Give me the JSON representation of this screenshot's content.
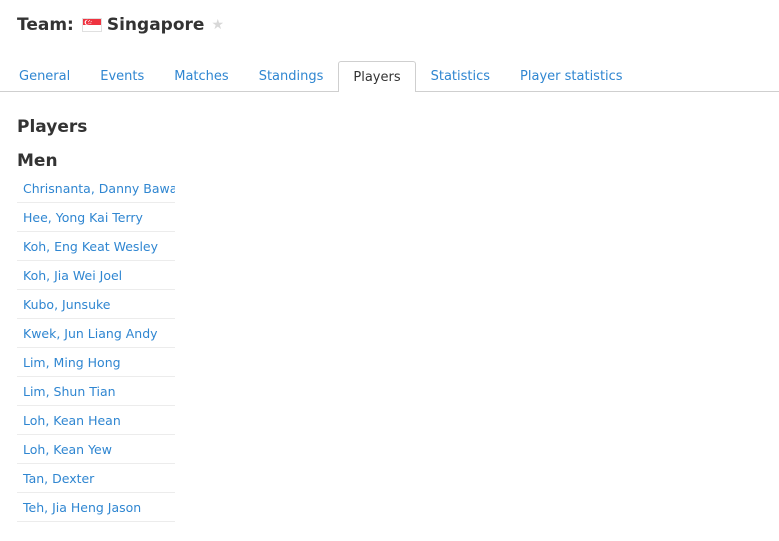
{
  "header": {
    "prefix": "Team:",
    "team_name": "Singapore",
    "flag_colors": {
      "top": "#ef3340",
      "bottom": "#ffffff"
    },
    "flag_icon": "singapore-flag-icon",
    "favorite_icon": "star-icon",
    "favorite_glyph": "★"
  },
  "tabs": [
    {
      "label": "General",
      "active": false
    },
    {
      "label": "Events",
      "active": false
    },
    {
      "label": "Matches",
      "active": false
    },
    {
      "label": "Standings",
      "active": false
    },
    {
      "label": "Players",
      "active": true
    },
    {
      "label": "Statistics",
      "active": false
    },
    {
      "label": "Player statistics",
      "active": false
    }
  ],
  "section": {
    "title": "Players",
    "group": "Men",
    "players": [
      "Chrisnanta, Danny Bawa",
      "Hee, Yong Kai Terry",
      "Koh, Eng Keat Wesley",
      "Koh, Jia Wei Joel",
      "Kubo, Junsuke",
      "Kwek, Jun Liang Andy",
      "Lim, Ming Hong",
      "Lim, Shun Tian",
      "Loh, Kean Hean",
      "Loh, Kean Yew",
      "Tan, Dexter",
      "Teh, Jia Heng Jason"
    ]
  },
  "colors": {
    "link": "#2f86d1",
    "text": "#333333",
    "border": "#cfcfcf"
  }
}
